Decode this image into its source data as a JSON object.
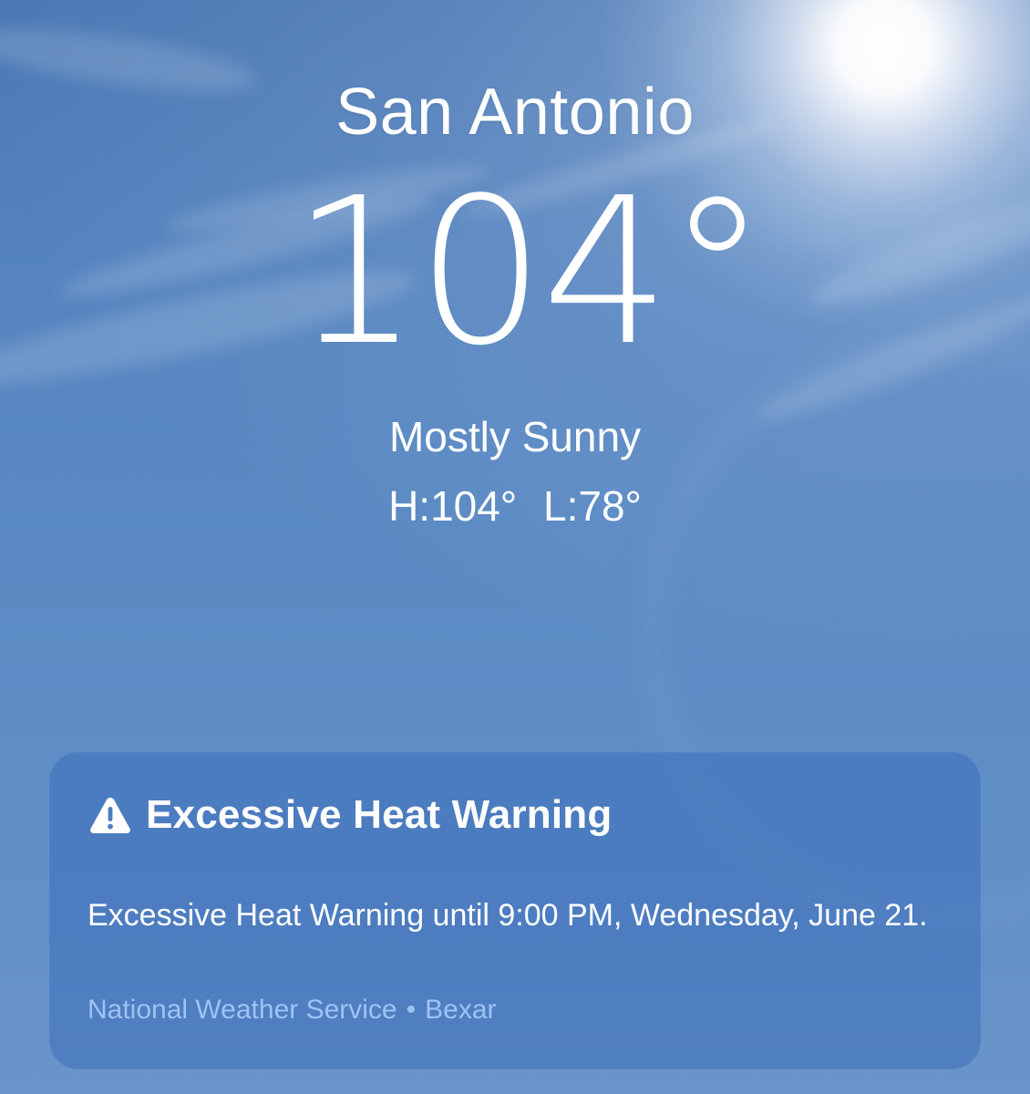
{
  "weather": {
    "city": "San Antonio",
    "temperature": "104°",
    "condition": "Mostly Sunny",
    "high": "H:104°",
    "low": "L:78°"
  },
  "alert": {
    "icon": "warning-triangle-icon",
    "title": "Excessive Heat Warning",
    "body": "Excessive Heat Warning until 9:00 PM, Wednesday, June 21.",
    "source": "National Weather Service",
    "separator": "•",
    "region": "Bexar"
  },
  "colors": {
    "sky": "#5a89c3",
    "card": "#3c6eb9",
    "source_text": "#9ec3f3",
    "text": "#ffffff"
  }
}
